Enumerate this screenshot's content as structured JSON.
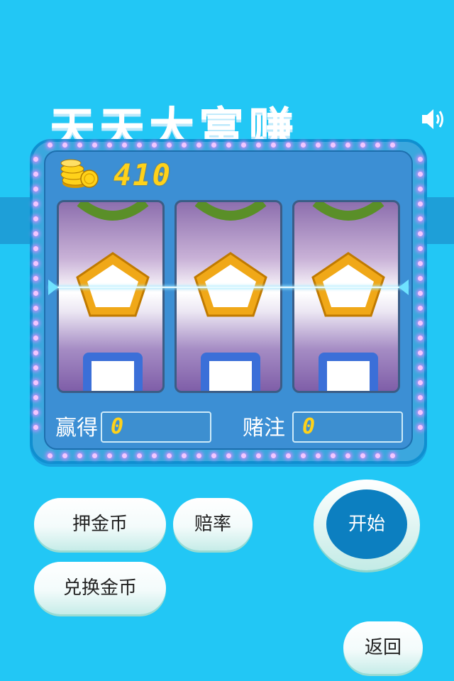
{
  "title": "天天大富赚",
  "icons": {
    "sound": "speaker-volume-icon",
    "coins": "gold-coin-stack-icon"
  },
  "coins": "410",
  "reels": [
    {
      "top": "green-ring",
      "center": "orange-pentagon",
      "bottom": "blue-square"
    },
    {
      "top": "green-ring",
      "center": "orange-pentagon",
      "bottom": "blue-square"
    },
    {
      "top": "green-ring",
      "center": "orange-pentagon",
      "bottom": "blue-square"
    }
  ],
  "win": {
    "label": "赢得",
    "value": "0"
  },
  "bet": {
    "label": "赌注",
    "value": "0"
  },
  "buttons": {
    "bet_coins": "押金币",
    "odds": "赔率",
    "start": "开始",
    "exchange": "兑换金币",
    "back": "返回"
  },
  "colors": {
    "background": "#22c7f5",
    "panel": "#3c8fd4",
    "accent": "#ffd21a",
    "start": "#0c7fc0"
  }
}
